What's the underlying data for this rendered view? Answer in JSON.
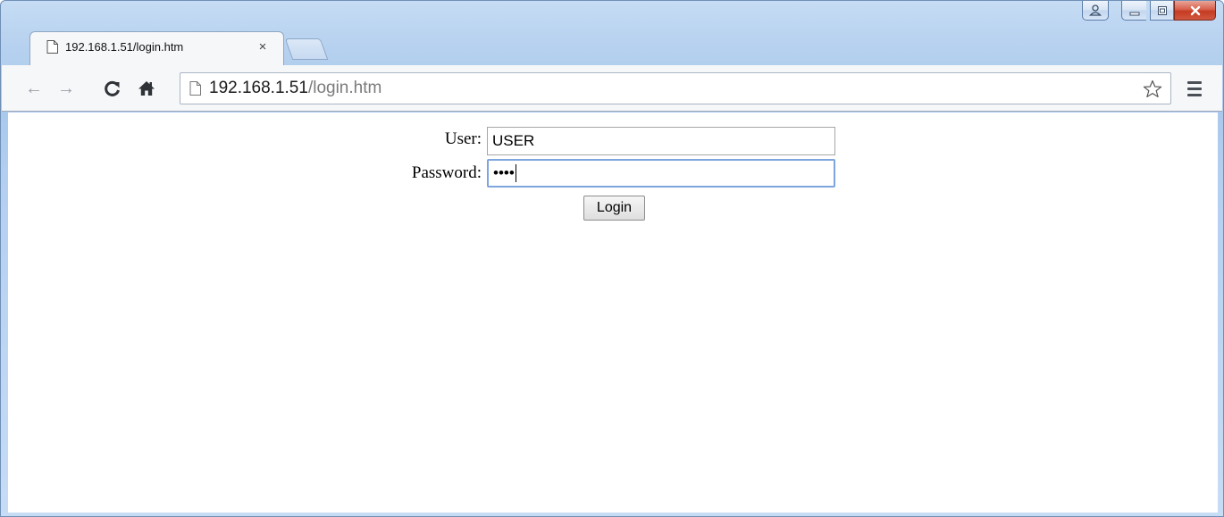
{
  "window": {
    "controls": {
      "profile_icon": "person-icon",
      "minimize_icon": "minimize-icon",
      "maximize_icon": "maximize-icon",
      "close_icon": "close-icon"
    }
  },
  "tabs": [
    {
      "title": "192.168.1.51/login.htm",
      "close_glyph": "×",
      "active": true
    }
  ],
  "toolbar": {
    "back_glyph": "←",
    "forward_glyph": "→",
    "reload_glyph": "C",
    "home_glyph": "⌂",
    "omnibox": {
      "host": "192.168.1.51",
      "path": "/login.htm"
    }
  },
  "login_form": {
    "user_label": "User:",
    "user_value": "USER",
    "password_label": "Password:",
    "password_masked": "••••",
    "submit_label": "Login"
  },
  "colors": {
    "frame": "#b9d3f0",
    "close_button": "#c43b22",
    "focus_ring": "#7fa5de"
  }
}
